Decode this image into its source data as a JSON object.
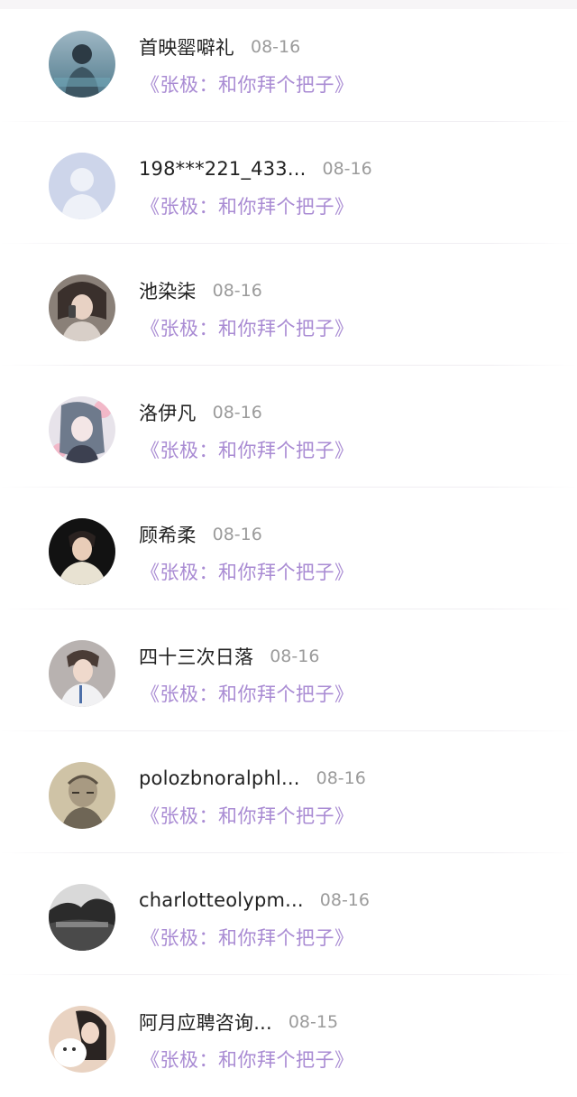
{
  "messages": [
    {
      "name": "首映罂噼礼",
      "date": "08-16",
      "text": "《张极：和你拜个把子》",
      "avatar": "photo-avatar-blue"
    },
    {
      "name": "198***221_433...",
      "date": "08-16",
      "text": "《张极：和你拜个把子》",
      "avatar": "default-avatar"
    },
    {
      "name": "池染柒",
      "date": "08-16",
      "text": "《张极：和你拜个把子》",
      "avatar": "photo-avatar-girl"
    },
    {
      "name": "洛伊凡",
      "date": "08-16",
      "text": "《张极：和你拜个把子》",
      "avatar": "anime-avatar"
    },
    {
      "name": "顾希柔",
      "date": "08-16",
      "text": "《张极：和你拜个把子》",
      "avatar": "photo-avatar-dark"
    },
    {
      "name": "四十三次日落",
      "date": "08-16",
      "text": "《张极：和你拜个把子》",
      "avatar": "photo-avatar-boy"
    },
    {
      "name": "polozbnoralphl...",
      "date": "08-16",
      "text": "《张极：和你拜个把子》",
      "avatar": "sketch-avatar"
    },
    {
      "name": "charlotteolypm...",
      "date": "08-16",
      "text": "《张极：和你拜个把子》",
      "avatar": "landscape-avatar"
    },
    {
      "name": "阿月应聘咨询...",
      "date": "08-15",
      "text": "《张极：和你拜个把子》",
      "avatar": "cat-avatar"
    }
  ],
  "colors": {
    "name": "#222222",
    "date": "#9b9b9b",
    "message": "#a98bd3",
    "background": "#ffffff"
  }
}
